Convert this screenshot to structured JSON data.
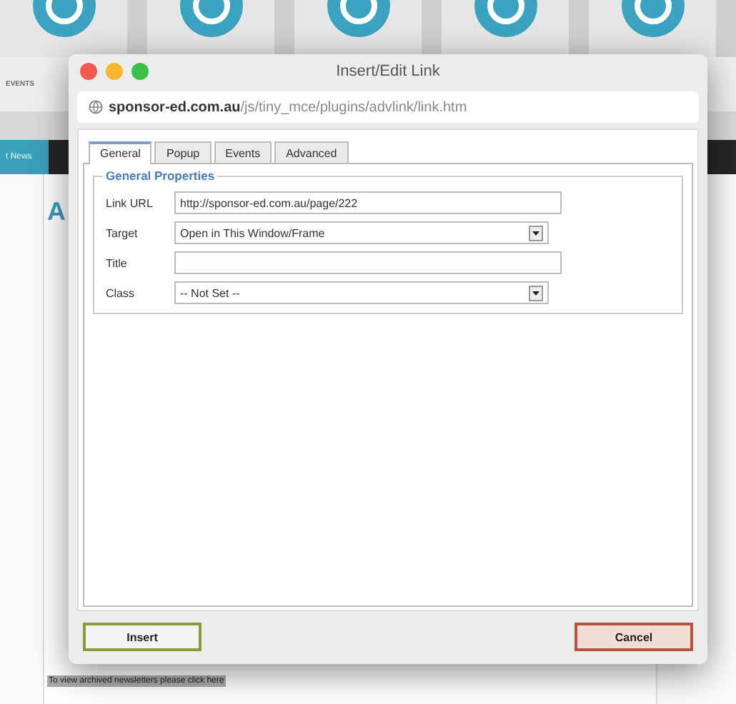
{
  "background_page": {
    "nav_label": "EVENTS",
    "news_tab": "t News",
    "heading": "A",
    "footer_link": "To view archived newsletters please click here"
  },
  "dialog": {
    "title": "Insert/Edit Link",
    "address": {
      "host": "sponsor-ed.com.au",
      "path": "/js/tiny_mce/plugins/advlink/link.htm"
    },
    "tabs": [
      {
        "label": "General",
        "selected": true
      },
      {
        "label": "Popup",
        "selected": false
      },
      {
        "label": "Events",
        "selected": false
      },
      {
        "label": "Advanced",
        "selected": false
      }
    ],
    "section_title": "General Properties",
    "fields": [
      {
        "kind": "input",
        "label": "Link URL",
        "value": "http://sponsor-ed.com.au/page/222"
      },
      {
        "kind": "select",
        "label": "Target",
        "value": "Open in This Window/Frame"
      },
      {
        "kind": "input",
        "label": "Title"
      },
      {
        "kind": "select",
        "label": "Class",
        "value": "-- Not Set --"
      }
    ],
    "buttons": [
      {
        "kind": "primary",
        "label": "Insert"
      },
      {
        "kind": "cancel",
        "label": "Cancel"
      }
    ]
  }
}
